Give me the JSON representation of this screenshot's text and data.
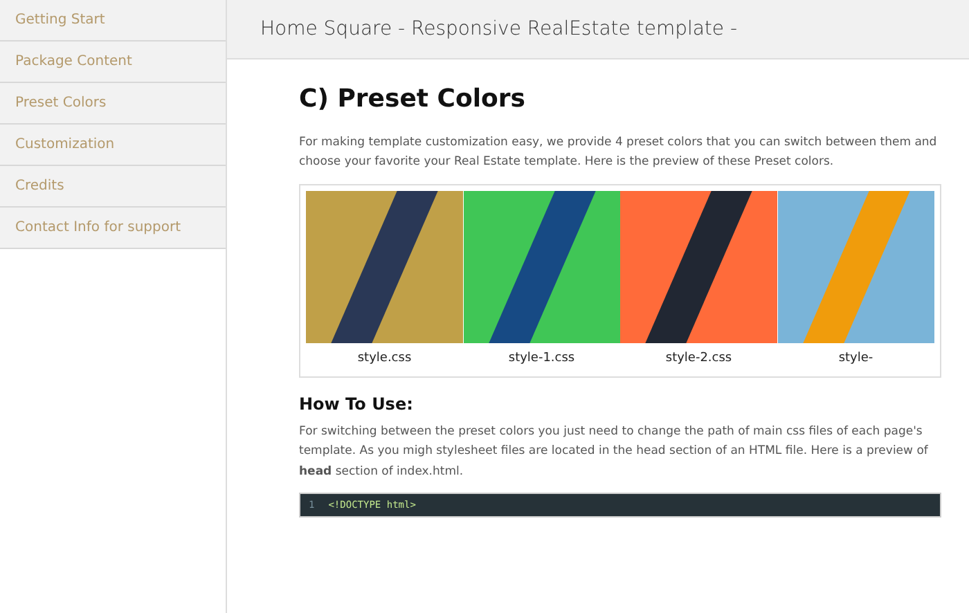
{
  "sidebar": {
    "items": [
      {
        "label": "Getting Start",
        "selected": false
      },
      {
        "label": "Package Content",
        "selected": false
      },
      {
        "label": "Preset Colors",
        "selected": false
      },
      {
        "label": "Customization",
        "selected": false
      },
      {
        "label": "Credits",
        "selected": false
      },
      {
        "label": "Contact Info for support",
        "selected": false
      }
    ]
  },
  "header": {
    "title": "Home Square - Responsive RealEstate template -"
  },
  "section": {
    "heading": "C) Preset Colors",
    "intro": "For making template customization easy, we provide 4 preset colors that you can switch between them and choose your favorite your Real Estate template. Here is the preview of these Preset colors.",
    "swatches": [
      {
        "label": "style.css",
        "color": "#c0a048",
        "stripe": {
          "color": "#2a3856"
        }
      },
      {
        "label": "style-1.css",
        "color": "#40c656",
        "stripe": {
          "color": "#174a84"
        }
      },
      {
        "label": "style-2.css",
        "color": "#ff6b3a",
        "stripe": {
          "color": "#212733"
        }
      },
      {
        "label": "style-",
        "color": "#7ab4d8",
        "stripe": {
          "color": "#f09c0c"
        }
      }
    ],
    "how_to_heading": "How To Use:",
    "how_to_text": "For switching between the preset colors you just need to change the path of main css files of each page's template. As you migh stylesheet files are located in the head section of an HTML file. Here is a preview of **head** section of index.html.",
    "code": {
      "lines": [
        {
          "number": "1",
          "text": "<!DOCTYPE html>"
        }
      ]
    }
  }
}
